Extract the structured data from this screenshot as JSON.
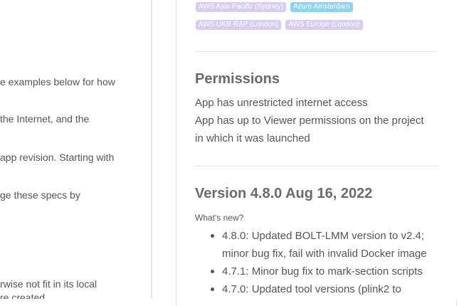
{
  "left_pane": {
    "lines": [
      "e examples below for how",
      "the Internet, and the",
      "app revision. Starting with",
      "ge these specs by",
      "rwise not fit in its local",
      "re created"
    ]
  },
  "regions": [
    [
      "AWS Asia Pacific (Sydney)",
      "Azure Amsterdam"
    ],
    [
      "AWS UKB-RAP (London)",
      "AWS Europe (London)"
    ]
  ],
  "permissions": {
    "heading": "Permissions",
    "lines": [
      "App has unrestricted internet access",
      "App has up to Viewer permissions on the project",
      "in which it was launched"
    ]
  },
  "version": {
    "heading": "Version 4.8.0 Aug 16, 2022",
    "whats_new": "What's new?",
    "notes": [
      "4.8.0: Updated BOLT-LMM version to v2.4; minor bug fix, fail with invalid Docker image",
      "4.7.1: Minor bug fix to mark-section scripts",
      "4.7.0: Updated tool versions (plink2 to"
    ]
  }
}
